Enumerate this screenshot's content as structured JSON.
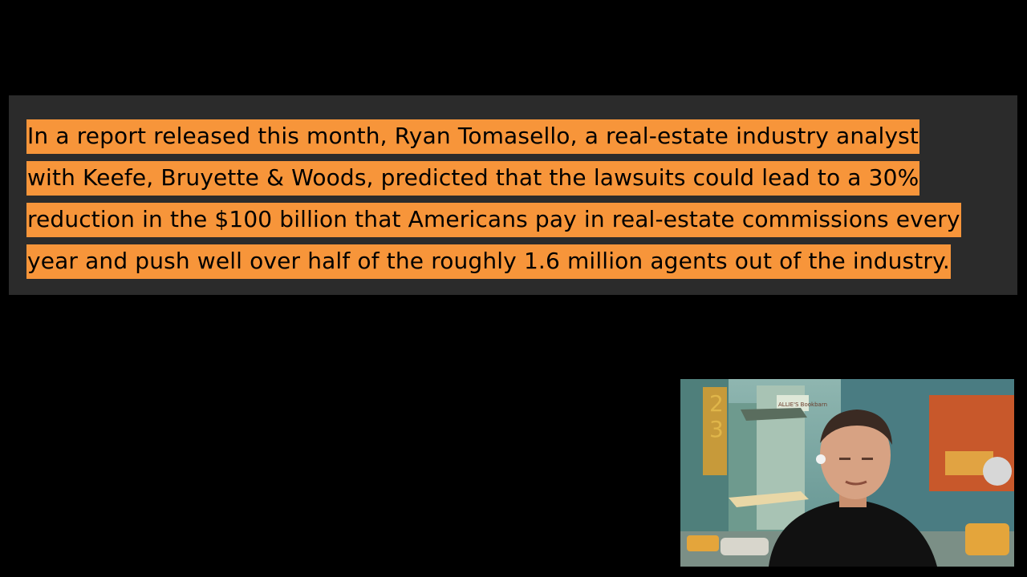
{
  "quote": {
    "lines": [
      "In a report released this month, Ryan Tomasello, a real-estate industry analyst",
      "with Keefe, Bruyette & Woods, predicted that the lawsuits could lead to a 30%",
      "reduction in the $100 billion that Americans pay in real-estate commissions every",
      "year and push well over half of the roughly 1.6 million agents out of the industry."
    ]
  },
  "colors": {
    "page_background": "#000000",
    "panel_background": "#2b2b2b",
    "highlight": "#f7953a",
    "text": "#000000"
  },
  "webcam": {
    "sign_text": "ALLIE'S Bookbarn"
  }
}
